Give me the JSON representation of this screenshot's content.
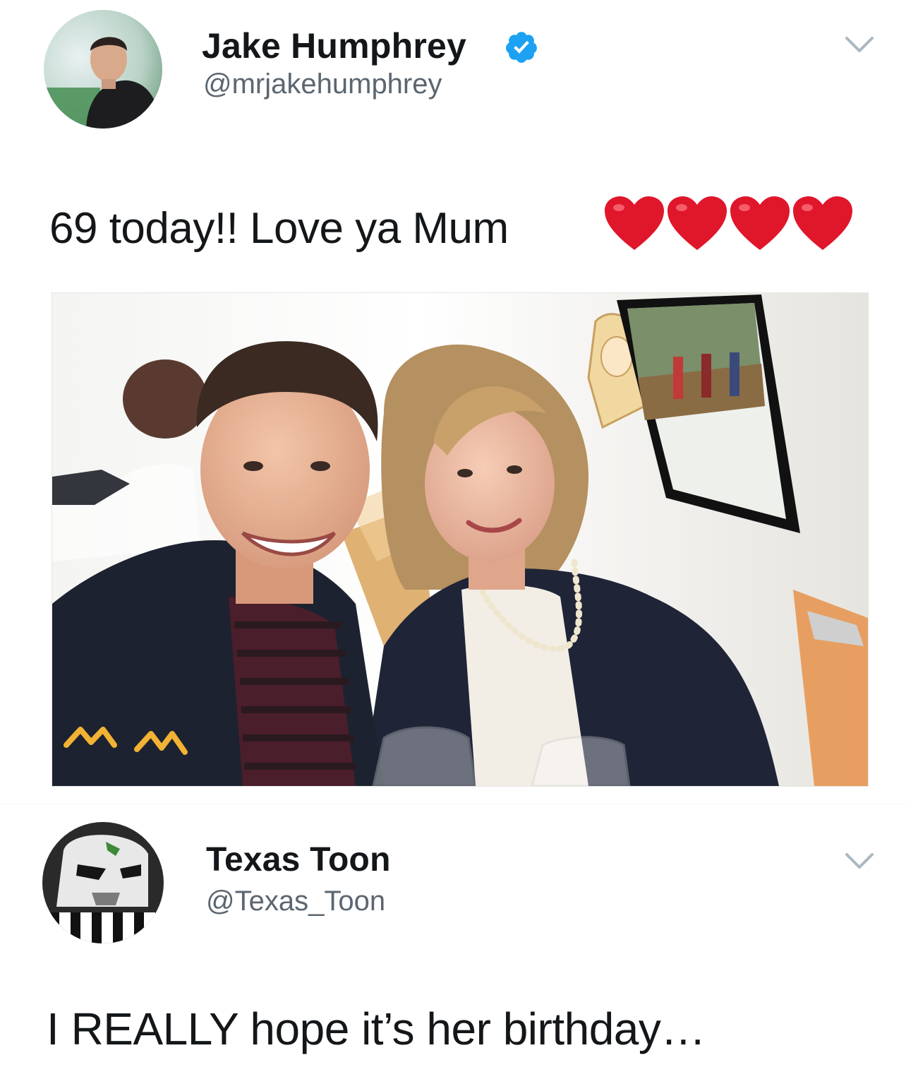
{
  "tweets": [
    {
      "display_name": "Jake Humphrey",
      "handle": "@mrjakehumphrey",
      "verified": true,
      "text": "69 today!! Love ya Mum",
      "emoji": [
        "red-heart",
        "red-heart",
        "red-heart",
        "red-heart"
      ],
      "has_photo": true
    },
    {
      "display_name": "Texas Toon",
      "handle": "@Texas_Toon",
      "verified": false,
      "text": "I REALLY hope it’s her birthday…"
    }
  ],
  "photo": {
    "caption_text": "",
    "doodle_text": "M M"
  },
  "colors": {
    "verified_blue": "#1da1f2",
    "heart_red": "#e0162b",
    "text": "#14171a",
    "handle_gray": "#5b6670",
    "chevron_gray": "#aab8c2"
  }
}
